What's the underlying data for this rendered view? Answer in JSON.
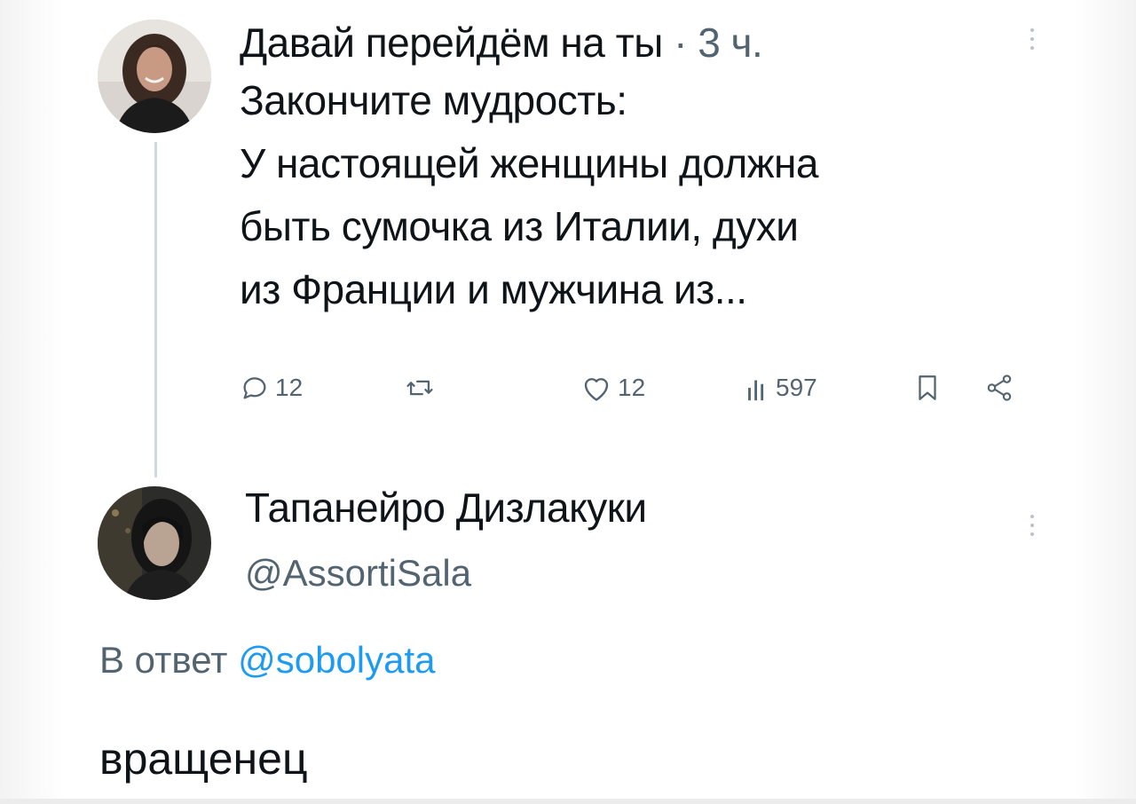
{
  "original_tweet": {
    "display_name": "Давай перейдём на ты",
    "separator": "·",
    "time": "3 ч.",
    "text_lines": [
      "Закончите мудрость:",
      "У настоящей женщины должна",
      "быть сумочка из Италии, духи",
      "из Франции и мужчина из..."
    ],
    "actions": {
      "reply_count": "12",
      "retweet_count": "",
      "like_count": "12",
      "views_count": "597",
      "reply_icon": "reply-icon",
      "retweet_icon": "retweet-icon",
      "like_icon": "heart-icon",
      "views_icon": "views-icon",
      "bookmark_icon": "bookmark-icon",
      "share_icon": "share-icon"
    }
  },
  "reply_tweet": {
    "display_name": "Тапанейро Дизлакуки",
    "handle": "@AssortiSala",
    "reply_to_prefix": "В ответ",
    "reply_to_handle": "@sobolyata",
    "text": "вращенец"
  },
  "colors": {
    "text_primary": "#0f1419",
    "text_secondary": "#536471",
    "link": "#1d9bf0",
    "thread_line": "#cfd9de"
  }
}
